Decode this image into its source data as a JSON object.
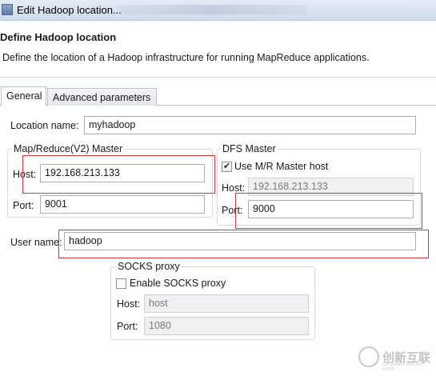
{
  "window": {
    "title": "Edit Hadoop location..."
  },
  "header": {
    "title": "Define Hadoop location",
    "description": "Define the location of a Hadoop infrastructure for running MapReduce applications."
  },
  "tabs": [
    {
      "label": "General",
      "selected": true
    },
    {
      "label": "Advanced parameters",
      "selected": false
    }
  ],
  "location": {
    "label": "Location name:",
    "value": "myhadoop"
  },
  "mr_master": {
    "title": "Map/Reduce(V2) Master",
    "host_label": "Host:",
    "host_value": "192.168.213.133",
    "port_label": "Port:",
    "port_value": "9001"
  },
  "dfs_master": {
    "title": "DFS Master",
    "use_mr_label": "Use M/R Master host",
    "use_mr_checked": true,
    "host_label": "Host:",
    "host_value": "192.168.213.133",
    "port_label": "Port:",
    "port_value": "9000"
  },
  "user": {
    "label": "User name:",
    "value": "hadoop"
  },
  "socks": {
    "title": "SOCKS proxy",
    "enable_label": "Enable SOCKS proxy",
    "enable_checked": false,
    "host_label": "Host:",
    "host_value": "host",
    "port_label": "Port:",
    "port_value": "1080"
  },
  "watermark": {
    "brand": "创新互联",
    "sub": "CHUANG XIN HU LIAN"
  },
  "colors": {
    "highlight_box": "#d3373f",
    "title_bar": "#d6e1ee",
    "focus_border": "#7eb4ea"
  }
}
